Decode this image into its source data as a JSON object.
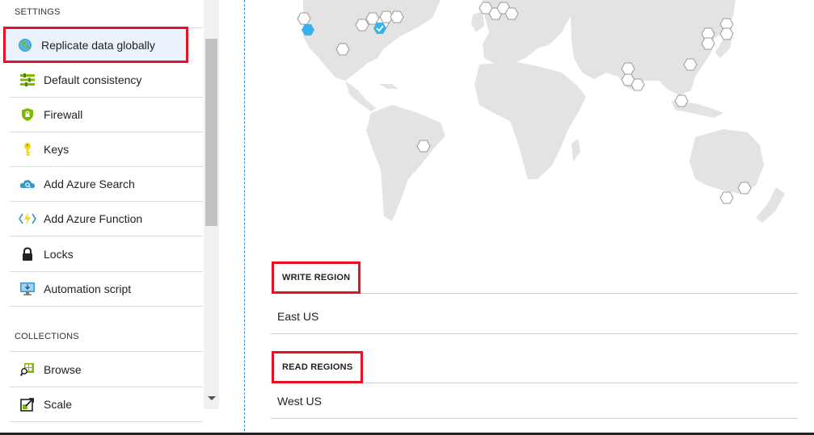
{
  "sidebar": {
    "settings_title": "SETTINGS",
    "collections_title": "COLLECTIONS",
    "items": [
      {
        "label": "Replicate data globally",
        "icon": "globe-icon"
      },
      {
        "label": "Default consistency",
        "icon": "consistency-bars-icon"
      },
      {
        "label": "Firewall",
        "icon": "shield-icon"
      },
      {
        "label": "Keys",
        "icon": "key-icon"
      },
      {
        "label": "Add Azure Search",
        "icon": "cloud-search-icon"
      },
      {
        "label": "Add Azure Function",
        "icon": "function-bolt-icon"
      },
      {
        "label": "Locks",
        "icon": "lock-icon"
      },
      {
        "label": "Automation script",
        "icon": "automation-monitor-icon"
      }
    ],
    "collection_items": [
      {
        "label": "Browse",
        "icon": "browse-grid-icon"
      },
      {
        "label": "Scale",
        "icon": "scale-arrow-icon"
      }
    ]
  },
  "regions": {
    "write_header": "WRITE REGION",
    "write_value": "East US",
    "read_header": "READ REGIONS",
    "read_value": "West US"
  },
  "colors": {
    "highlight": "#e81123",
    "map_land": "#e3e3e3",
    "region_selected": "#38b1ee",
    "hexagon_outline": "#9a9a9a"
  }
}
